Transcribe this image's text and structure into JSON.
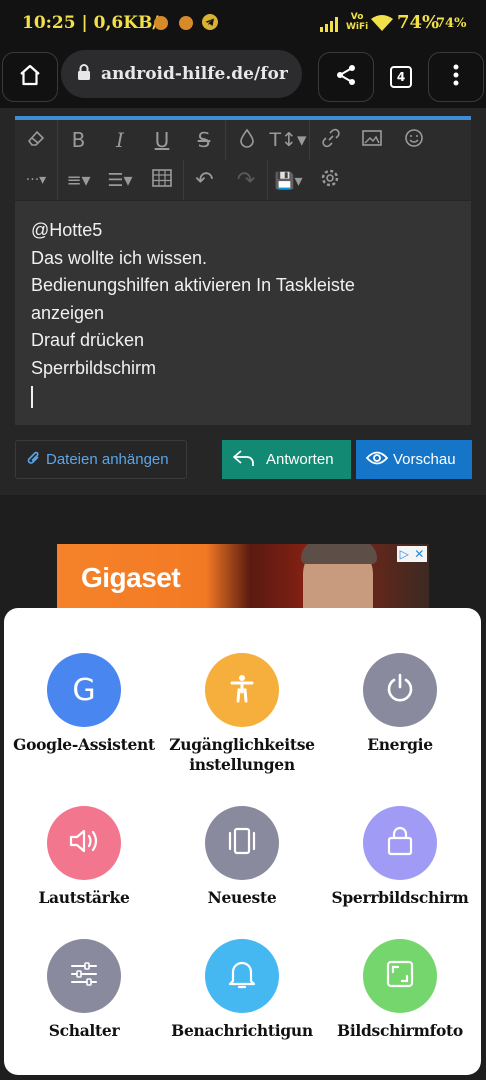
{
  "status_bar": {
    "time": "10:25",
    "network_speed": "0,6KB/s",
    "wifi_label_top": "Vo",
    "wifi_label_bottom": "WiFi",
    "battery": "74%",
    "battery_secondary": "74%"
  },
  "browser": {
    "url": "android-hilfe.de/for",
    "tab_count": "4"
  },
  "editor": {
    "lines": [
      "@Hotte5",
      "Das wollte ich wissen.",
      "Bedienungshilfen aktivieren In Taskleiste",
      "anzeigen",
      "Drauf drücken",
      "Sperrbildschirm"
    ],
    "attach_label": "Dateien anhängen",
    "reply_label": "Antworten",
    "preview_label": "Vorschau"
  },
  "ad": {
    "brand": "Gigaset"
  },
  "accessibility_menu": {
    "items": [
      {
        "label": "Google-Assistent",
        "icon": "google-g-icon",
        "color": "#4a86f0"
      },
      {
        "label": "Zugänglichkeitse\ninstellungen",
        "icon": "accessibility-person-icon",
        "color": "#f6ae3d"
      },
      {
        "label": "Energie",
        "icon": "power-icon",
        "color": "#8a8a9e"
      },
      {
        "label": "Lautstärke",
        "icon": "volume-icon",
        "color": "#f3768f"
      },
      {
        "label": "Neueste",
        "icon": "recents-icon",
        "color": "#8a8a9e"
      },
      {
        "label": "Sperrbildschirm",
        "icon": "lock-icon",
        "color": "#a09bf5"
      },
      {
        "label": "Schalter",
        "icon": "sliders-icon",
        "color": "#8a8a9e"
      },
      {
        "label": "Benachrichtigun",
        "icon": "bell-icon",
        "color": "#45b8f2"
      },
      {
        "label": "Bildschirmfoto",
        "icon": "screenshot-icon",
        "color": "#74d66c"
      }
    ]
  }
}
